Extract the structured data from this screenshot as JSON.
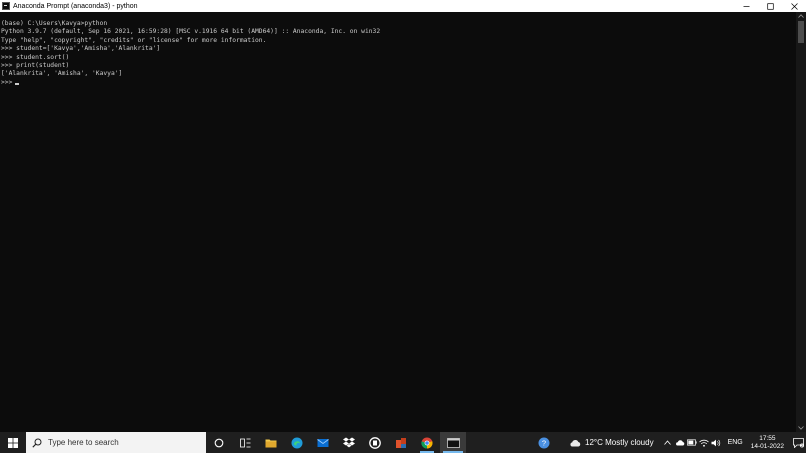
{
  "window": {
    "title": "Anaconda Prompt (anaconda3) - python"
  },
  "console": {
    "lines": [
      "(base) C:\\Users\\Kavya>python",
      "Python 3.9.7 (default, Sep 16 2021, 16:59:28) [MSC v.1916 64 bit (AMD64)] :: Anaconda, Inc. on win32",
      "Type \"help\", \"copyright\", \"credits\" or \"license\" for more information.",
      ">>> student=['Kavya','Amisha','Alankrita']",
      ">>> student.sort()",
      ">>> print(student)",
      "['Alankrita', 'Amisha', 'Kavya']"
    ],
    "prompt": ">>>"
  },
  "taskbar": {
    "search_placeholder": "Type here to search",
    "apps": [
      {
        "name": "cortana-icon"
      },
      {
        "name": "task-view-icon"
      },
      {
        "name": "file-explorer-icon"
      },
      {
        "name": "edge-icon"
      },
      {
        "name": "mail-icon"
      },
      {
        "name": "dropbox-icon"
      },
      {
        "name": "app-circle-icon"
      },
      {
        "name": "office-icon"
      },
      {
        "name": "chrome-icon"
      },
      {
        "name": "terminal-icon"
      }
    ],
    "weather": "12°C  Mostly cloudy",
    "language": "ENG",
    "time": "17:55",
    "date": "14-01-2022"
  },
  "colors": {
    "console_bg": "#0c0c0c",
    "console_fg": "#cccccc",
    "taskbar_bg": "#1f1f1f",
    "accent": "#76b9ed"
  }
}
